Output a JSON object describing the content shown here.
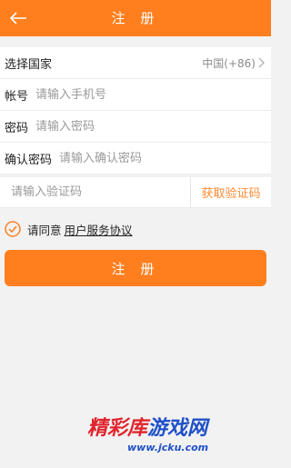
{
  "header": {
    "title": "注 册",
    "back_icon": "arrow-left-icon"
  },
  "form": {
    "country": {
      "label": "选择国家",
      "value": "中国(+86)",
      "icon": "chevron-right-icon"
    },
    "account": {
      "label": "帐号",
      "placeholder": "请输入手机号"
    },
    "password": {
      "label": "密码",
      "placeholder": "请输入密码"
    },
    "confirm": {
      "label": "确认密码",
      "placeholder": "请输入确认密码"
    }
  },
  "verify": {
    "placeholder": "请输入验证码",
    "get_code_label": "获取验证码"
  },
  "agreement": {
    "prefix": "请同意",
    "link": "用户服务协议",
    "checked": true,
    "icon": "check-circle-icon"
  },
  "submit_label": "注 册",
  "watermark": {
    "part1": "精彩库",
    "part2": "游戏网",
    "url": "www.jcku.com"
  },
  "colors": {
    "accent": "#ff7f1f",
    "link_orange": "#ff8a33",
    "background": "#f2f2f2"
  }
}
